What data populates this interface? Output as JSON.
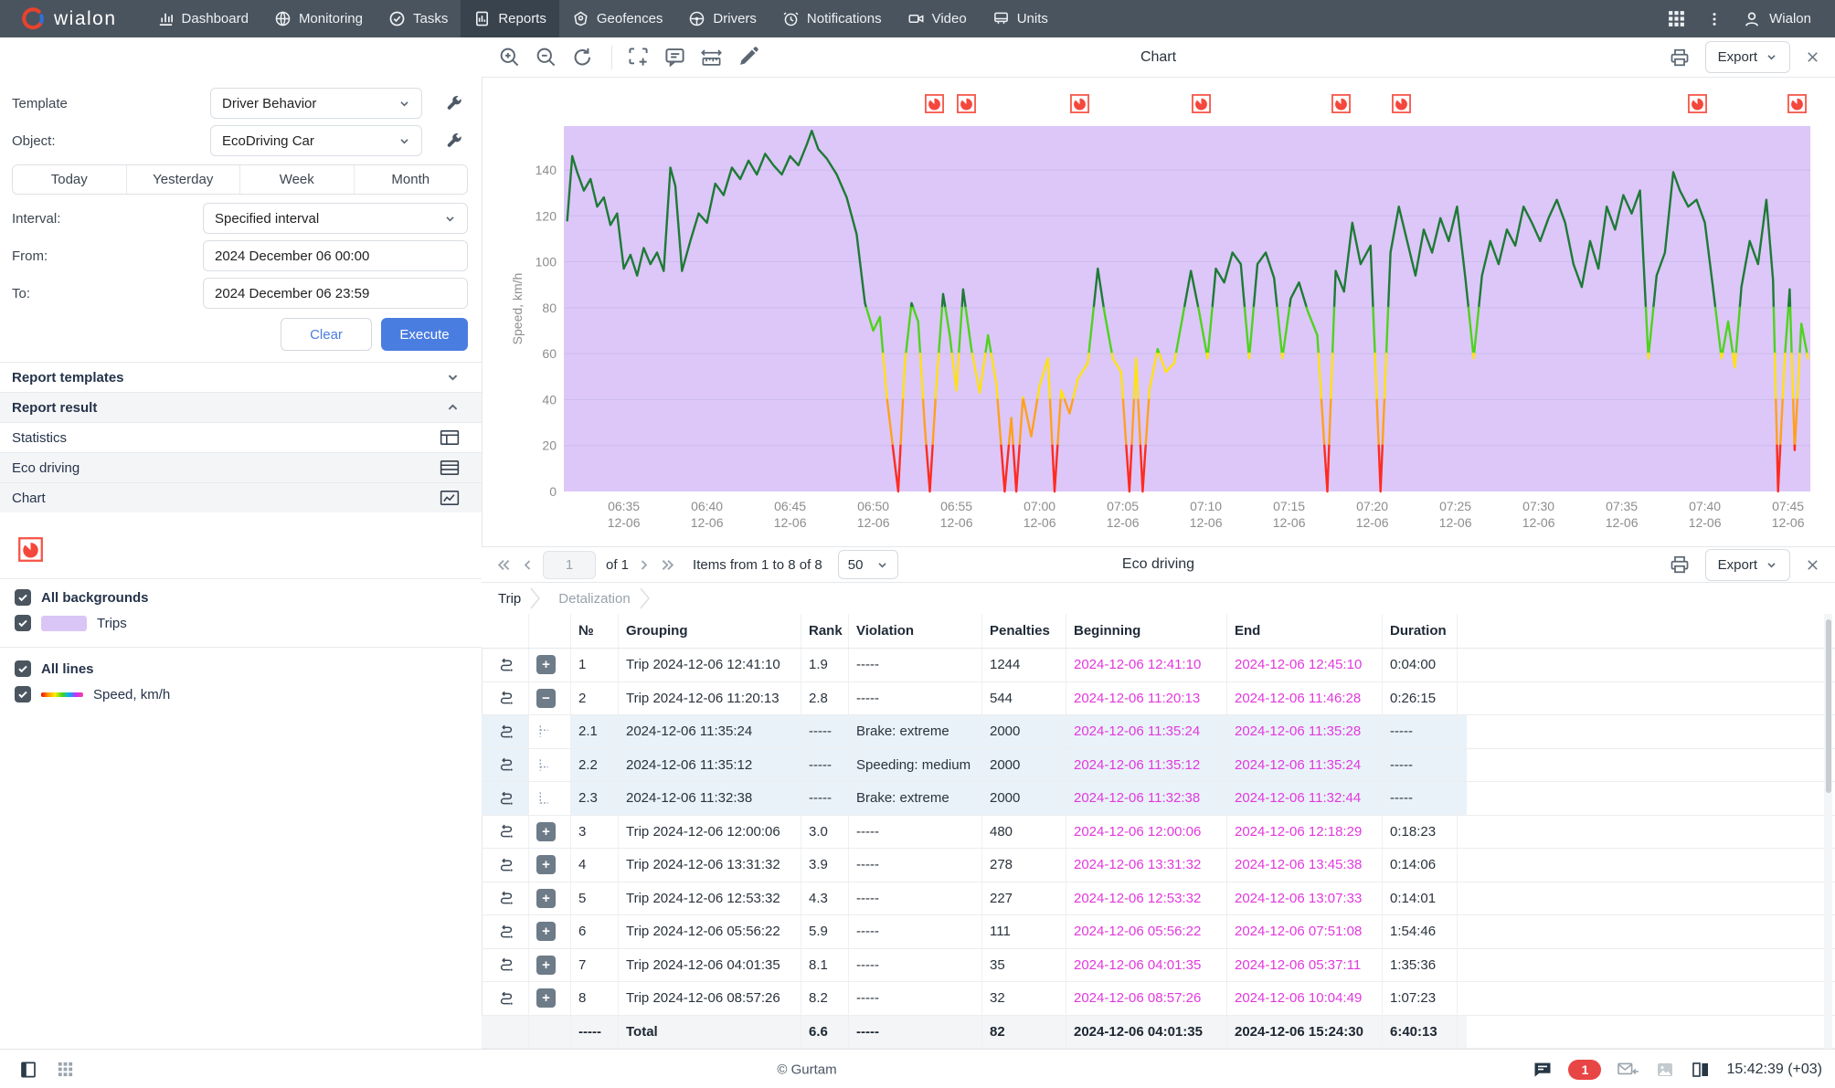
{
  "nav": {
    "brand": "wialon",
    "items": [
      {
        "label": "Dashboard",
        "icon": "dashboard-icon",
        "active": false
      },
      {
        "label": "Monitoring",
        "icon": "monitoring-icon",
        "active": false
      },
      {
        "label": "Tasks",
        "icon": "tasks-icon",
        "active": false
      },
      {
        "label": "Reports",
        "icon": "reports-icon",
        "active": true
      },
      {
        "label": "Geofences",
        "icon": "geofences-icon",
        "active": false
      },
      {
        "label": "Drivers",
        "icon": "drivers-icon",
        "active": false
      },
      {
        "label": "Notifications",
        "icon": "notifications-icon",
        "active": false
      },
      {
        "label": "Video",
        "icon": "video-icon",
        "active": false
      },
      {
        "label": "Units",
        "icon": "units-icon",
        "active": false
      }
    ],
    "user": "Wialon"
  },
  "sidebar": {
    "template_label": "Template",
    "template_value": "Driver Behavior",
    "object_label": "Object:",
    "object_value": "EcoDriving Car",
    "quick_ranges": [
      "Today",
      "Yesterday",
      "Week",
      "Month"
    ],
    "interval_label": "Interval:",
    "interval_value": "Specified interval",
    "from_label": "From:",
    "from_value": "2024 December 06 00:00",
    "to_label": "To:",
    "to_value": "2024 December 06 23:59",
    "clear_label": "Clear",
    "execute_label": "Execute",
    "sections": [
      {
        "label": "Report templates",
        "chevron": "down",
        "bold": true,
        "shaded": false
      },
      {
        "label": "Report result",
        "chevron": "up",
        "bold": true,
        "shaded": true
      },
      {
        "label": "Statistics",
        "icon": "statistics-table-icon",
        "shaded": false
      },
      {
        "label": "Eco driving",
        "icon": "eco-driving-table-icon",
        "shaded": true
      },
      {
        "label": "Chart",
        "icon": "chart-table-icon",
        "shaded": true
      }
    ],
    "legend": {
      "violation_icon": "speedometer-icon",
      "groups": [
        {
          "label": "All backgrounds",
          "checked": true,
          "items": [
            {
              "label": "Trips",
              "checked": true,
              "swatch_type": "fill",
              "swatch_color": "#d9c6f6"
            }
          ]
        },
        {
          "label": "All lines",
          "checked": true,
          "items": [
            {
              "label": "Speed, km/h",
              "checked": true,
              "swatch_type": "gradient"
            }
          ]
        }
      ]
    }
  },
  "chart_panel": {
    "title": "Chart",
    "toolbar": [
      "zoom-in-icon",
      "zoom-out-icon",
      "reset-zoom-icon",
      "select-area-icon",
      "comment-icon",
      "ruler-icon",
      "pencil-icon"
    ],
    "export_label": "Export"
  },
  "chart_data": {
    "type": "line",
    "title": "Speed over time with trip background",
    "ylabel": "Speed, km/h",
    "ylim": [
      0,
      159
    ],
    "yticks": [
      0,
      20,
      40,
      60,
      80,
      100,
      120,
      140
    ],
    "time_base": "minutes after 06:30, 2024-12-06",
    "x_ticks": [
      [
        5,
        "06:35"
      ],
      [
        10,
        "06:40"
      ],
      [
        15,
        "06:45"
      ],
      [
        20,
        "06:50"
      ],
      [
        25,
        "06:55"
      ],
      [
        30,
        "07:00"
      ],
      [
        35,
        "07:05"
      ],
      [
        40,
        "07:10"
      ],
      [
        45,
        "07:15"
      ],
      [
        50,
        "07:20"
      ],
      [
        55,
        "07:25"
      ],
      [
        60,
        "07:30"
      ],
      [
        65,
        "07:35"
      ],
      [
        70,
        "07:40"
      ],
      [
        75,
        "07:45"
      ]
    ],
    "x_tick_date": "12-06",
    "background_band": {
      "label": "Trips",
      "color": "#dcc7f8",
      "grid_color": "#cdbaee"
    },
    "speed_color_bands": [
      {
        "max": 20,
        "color": "#ff2b20"
      },
      {
        "max": 40,
        "color": "#ffa01e"
      },
      {
        "max": 60,
        "color": "#ffe113"
      },
      {
        "max": 80,
        "color": "#4ed31d"
      },
      {
        "max": 999,
        "color": "#1e7a36"
      }
    ],
    "violation_marker_fractions": [
      0.298,
      0.323,
      0.414,
      0.512,
      0.624,
      0.672,
      0.91,
      0.99
    ],
    "series": [
      {
        "name": "Speed, km/h",
        "points": [
          [
            1.6,
            118
          ],
          [
            1.9,
            146
          ],
          [
            2.2,
            139
          ],
          [
            2.6,
            131
          ],
          [
            3.0,
            136
          ],
          [
            3.4,
            124
          ],
          [
            3.8,
            128
          ],
          [
            4.2,
            116
          ],
          [
            4.6,
            121
          ],
          [
            5.0,
            97
          ],
          [
            5.4,
            103
          ],
          [
            5.8,
            94
          ],
          [
            6.2,
            106
          ],
          [
            6.6,
            99
          ],
          [
            7.0,
            104
          ],
          [
            7.4,
            96
          ],
          [
            7.8,
            141
          ],
          [
            8.1,
            133
          ],
          [
            8.5,
            96
          ],
          [
            9.0,
            109
          ],
          [
            9.5,
            121
          ],
          [
            10.0,
            117
          ],
          [
            10.5,
            134
          ],
          [
            11.0,
            129
          ],
          [
            11.5,
            141
          ],
          [
            12.0,
            136
          ],
          [
            12.5,
            144
          ],
          [
            13.0,
            138
          ],
          [
            13.5,
            147
          ],
          [
            14.0,
            142
          ],
          [
            14.5,
            138
          ],
          [
            15.0,
            146
          ],
          [
            15.5,
            142
          ],
          [
            16.0,
            151
          ],
          [
            16.3,
            157
          ],
          [
            16.7,
            149
          ],
          [
            17.2,
            145
          ],
          [
            17.8,
            138
          ],
          [
            18.4,
            128
          ],
          [
            19.0,
            112
          ],
          [
            19.5,
            82
          ],
          [
            20.0,
            70
          ],
          [
            20.4,
            76
          ],
          [
            20.8,
            42
          ],
          [
            21.2,
            18
          ],
          [
            21.5,
            0
          ],
          [
            21.9,
            56
          ],
          [
            22.3,
            82
          ],
          [
            22.7,
            74
          ],
          [
            23.1,
            28
          ],
          [
            23.4,
            0
          ],
          [
            23.8,
            47
          ],
          [
            24.2,
            86
          ],
          [
            24.6,
            68
          ],
          [
            25.0,
            44
          ],
          [
            25.4,
            88
          ],
          [
            25.9,
            62
          ],
          [
            26.4,
            43
          ],
          [
            26.9,
            68
          ],
          [
            27.4,
            47
          ],
          [
            27.9,
            0
          ],
          [
            28.3,
            32
          ],
          [
            28.6,
            0
          ],
          [
            29.0,
            41
          ],
          [
            29.5,
            24
          ],
          [
            30.0,
            46
          ],
          [
            30.5,
            58
          ],
          [
            30.9,
            0
          ],
          [
            31.3,
            44
          ],
          [
            31.8,
            34
          ],
          [
            32.3,
            49
          ],
          [
            32.9,
            56
          ],
          [
            33.5,
            97
          ],
          [
            33.9,
            78
          ],
          [
            34.4,
            58
          ],
          [
            34.9,
            52
          ],
          [
            35.4,
            0
          ],
          [
            35.8,
            58
          ],
          [
            36.2,
            0
          ],
          [
            36.6,
            44
          ],
          [
            37.1,
            62
          ],
          [
            37.6,
            52
          ],
          [
            38.1,
            56
          ],
          [
            38.6,
            76
          ],
          [
            39.1,
            96
          ],
          [
            39.6,
            78
          ],
          [
            40.1,
            58
          ],
          [
            40.6,
            97
          ],
          [
            41.1,
            91
          ],
          [
            41.6,
            104
          ],
          [
            42.1,
            99
          ],
          [
            42.6,
            58
          ],
          [
            43.1,
            99
          ],
          [
            43.6,
            104
          ],
          [
            44.1,
            93
          ],
          [
            44.6,
            58
          ],
          [
            45.1,
            84
          ],
          [
            45.6,
            91
          ],
          [
            46.1,
            79
          ],
          [
            46.7,
            68
          ],
          [
            47.3,
            0
          ],
          [
            47.8,
            96
          ],
          [
            48.3,
            87
          ],
          [
            48.8,
            117
          ],
          [
            49.3,
            99
          ],
          [
            49.9,
            107
          ],
          [
            50.5,
            0
          ],
          [
            51.1,
            104
          ],
          [
            51.6,
            124
          ],
          [
            52.1,
            109
          ],
          [
            52.6,
            94
          ],
          [
            53.1,
            114
          ],
          [
            53.6,
            104
          ],
          [
            54.1,
            119
          ],
          [
            54.6,
            109
          ],
          [
            55.1,
            124
          ],
          [
            55.6,
            93
          ],
          [
            56.1,
            58
          ],
          [
            56.6,
            94
          ],
          [
            57.1,
            109
          ],
          [
            57.6,
            99
          ],
          [
            58.1,
            114
          ],
          [
            58.6,
            107
          ],
          [
            59.1,
            124
          ],
          [
            59.6,
            117
          ],
          [
            60.1,
            109
          ],
          [
            60.6,
            119
          ],
          [
            61.1,
            127
          ],
          [
            61.6,
            117
          ],
          [
            62.1,
            99
          ],
          [
            62.6,
            89
          ],
          [
            63.1,
            109
          ],
          [
            63.6,
            97
          ],
          [
            64.1,
            124
          ],
          [
            64.6,
            114
          ],
          [
            65.1,
            129
          ],
          [
            65.6,
            121
          ],
          [
            66.1,
            131
          ],
          [
            66.6,
            58
          ],
          [
            67.1,
            94
          ],
          [
            67.6,
            104
          ],
          [
            68.1,
            139
          ],
          [
            68.5,
            131
          ],
          [
            69.0,
            124
          ],
          [
            69.5,
            127
          ],
          [
            70.0,
            117
          ],
          [
            70.5,
            88
          ],
          [
            71.0,
            58
          ],
          [
            71.4,
            74
          ],
          [
            71.8,
            54
          ],
          [
            72.2,
            89
          ],
          [
            72.7,
            109
          ],
          [
            73.2,
            99
          ],
          [
            73.7,
            127
          ],
          [
            74.1,
            92
          ],
          [
            74.4,
            0
          ],
          [
            74.8,
            58
          ],
          [
            75.1,
            88
          ],
          [
            75.4,
            18
          ],
          [
            75.8,
            73
          ],
          [
            76.2,
            58
          ]
        ]
      }
    ]
  },
  "eco_panel": {
    "title": "Eco driving",
    "export_label": "Export",
    "pagination": {
      "page": "1",
      "of_label": "of 1",
      "items_label": "Items from 1 to 8 of 8",
      "page_size": "50"
    },
    "tabs": [
      {
        "label": "Trip",
        "active": true
      },
      {
        "label": "Detalization",
        "active": false
      }
    ],
    "table": {
      "columns": [
        "№",
        "Grouping",
        "Rank",
        "Violation",
        "Penalties",
        "Beginning",
        "End",
        "Duration"
      ],
      "rows": [
        {
          "type": "trip",
          "expand": "plus",
          "num": "1",
          "grouping": "Trip 2024-12-06 12:41:10",
          "rank": "1.9",
          "violation": "-----",
          "penalties": "1244",
          "begin": "2024-12-06 12:41:10",
          "end": "2024-12-06 12:45:10",
          "duration": "0:04:00"
        },
        {
          "type": "trip",
          "expand": "minus",
          "num": "2",
          "grouping": "Trip 2024-12-06 11:20:13",
          "rank": "2.8",
          "violation": "-----",
          "penalties": "544",
          "begin": "2024-12-06 11:20:13",
          "end": "2024-12-06 11:46:28",
          "duration": "0:26:15"
        },
        {
          "type": "sub",
          "num": "2.1",
          "grouping": "2024-12-06 11:35:24",
          "rank": "-----",
          "violation": "Brake: extreme",
          "penalties": "2000",
          "begin": "2024-12-06 11:35:24",
          "end": "2024-12-06 11:35:28",
          "duration": "-----"
        },
        {
          "type": "sub",
          "num": "2.2",
          "grouping": "2024-12-06 11:35:12",
          "rank": "-----",
          "violation": "Speeding: medium",
          "penalties": "2000",
          "begin": "2024-12-06 11:35:12",
          "end": "2024-12-06 11:35:24",
          "duration": "-----"
        },
        {
          "type": "sub",
          "num": "2.3",
          "grouping": "2024-12-06 11:32:38",
          "rank": "-----",
          "violation": "Brake: extreme",
          "penalties": "2000",
          "begin": "2024-12-06 11:32:38",
          "end": "2024-12-06 11:32:44",
          "duration": "-----"
        },
        {
          "type": "trip",
          "expand": "plus",
          "num": "3",
          "grouping": "Trip 2024-12-06 12:00:06",
          "rank": "3.0",
          "violation": "-----",
          "penalties": "480",
          "begin": "2024-12-06 12:00:06",
          "end": "2024-12-06 12:18:29",
          "duration": "0:18:23"
        },
        {
          "type": "trip",
          "expand": "plus",
          "num": "4",
          "grouping": "Trip 2024-12-06 13:31:32",
          "rank": "3.9",
          "violation": "-----",
          "penalties": "278",
          "begin": "2024-12-06 13:31:32",
          "end": "2024-12-06 13:45:38",
          "duration": "0:14:06"
        },
        {
          "type": "trip",
          "expand": "plus",
          "num": "5",
          "grouping": "Trip 2024-12-06 12:53:32",
          "rank": "4.3",
          "violation": "-----",
          "penalties": "227",
          "begin": "2024-12-06 12:53:32",
          "end": "2024-12-06 13:07:33",
          "duration": "0:14:01"
        },
        {
          "type": "trip",
          "expand": "plus",
          "num": "6",
          "grouping": "Trip 2024-12-06 05:56:22",
          "rank": "5.9",
          "violation": "-----",
          "penalties": "111",
          "begin": "2024-12-06 05:56:22",
          "end": "2024-12-06 07:51:08",
          "duration": "1:54:46"
        },
        {
          "type": "trip",
          "expand": "plus",
          "num": "7",
          "grouping": "Trip 2024-12-06 04:01:35",
          "rank": "8.1",
          "violation": "-----",
          "penalties": "35",
          "begin": "2024-12-06 04:01:35",
          "end": "2024-12-06 05:37:11",
          "duration": "1:35:36"
        },
        {
          "type": "trip",
          "expand": "plus",
          "num": "8",
          "grouping": "Trip 2024-12-06 08:57:26",
          "rank": "8.2",
          "violation": "-----",
          "penalties": "32",
          "begin": "2024-12-06 08:57:26",
          "end": "2024-12-06 10:04:49",
          "duration": "1:07:23"
        },
        {
          "type": "total",
          "num": "-----",
          "grouping": "Total",
          "rank": "6.6",
          "violation": "-----",
          "penalties": "82",
          "begin": "2024-12-06 04:01:35",
          "end": "2024-12-06 15:24:30",
          "duration": "6:40:13"
        }
      ]
    }
  },
  "statusbar": {
    "copyright": "© Gurtam",
    "badge": "1",
    "time": "15:42:39 (+03)"
  }
}
